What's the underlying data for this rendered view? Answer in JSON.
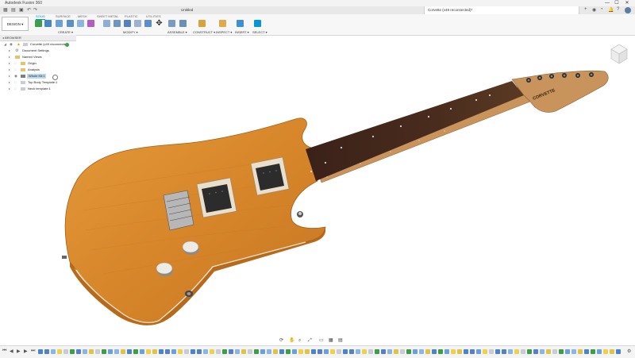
{
  "app": {
    "title": "Autodesk Fusion 360",
    "window_controls": [
      "—",
      "☐",
      "✕"
    ]
  },
  "tabs": [
    {
      "label": "Untitled",
      "active": false
    },
    {
      "label": "Corvette (v49 reconnected)*",
      "active": true
    }
  ],
  "ribbon": {
    "workspace_button": "DESIGN ▾",
    "tabs": [
      "SOLID",
      "SURFACE",
      "MESH",
      "SHEET METAL",
      "PLASTIC",
      "UTILITIES"
    ],
    "active_tab": "SOLID",
    "groups": [
      "CREATE ▾",
      "MODIFY ▾",
      "ASSEMBLE ▾",
      "CONSTRUCT ▾",
      "INSPECT ▾",
      "INSERT ▾",
      "SELECT ▾"
    ]
  },
  "browser": {
    "header": "BROWSER",
    "items": [
      {
        "label": "Corvette (v49 reconnected)",
        "indent": 0
      },
      {
        "label": "Document Settings",
        "indent": 1
      },
      {
        "label": "Named Views",
        "indent": 1
      },
      {
        "label": "Origin",
        "indent": 1
      },
      {
        "label": "Analysis",
        "indent": 1
      },
      {
        "label": "Whole Kit:1",
        "indent": 1
      },
      {
        "label": "Top Body Template:1",
        "indent": 1
      },
      {
        "label": "Neck template:1",
        "indent": 1
      }
    ]
  },
  "headstock_text": "CORVETTE",
  "colors": {
    "accent": "#0696d7",
    "body_wood": "#d88a2a",
    "fretboard": "#3c2319",
    "neck_wood": "#c9935c"
  },
  "icons": [
    "undo-icon",
    "redo-icon",
    "save-icon",
    "file-icon",
    "search-icon",
    "help-icon",
    "notification-icon",
    "user-icon",
    "eye-icon",
    "orbit-icon",
    "pan-icon",
    "zoom-icon",
    "display-settings-icon",
    "grid-icon",
    "viewcube-icon",
    "play-icon",
    "prev-icon",
    "next-icon",
    "settings-icon"
  ]
}
